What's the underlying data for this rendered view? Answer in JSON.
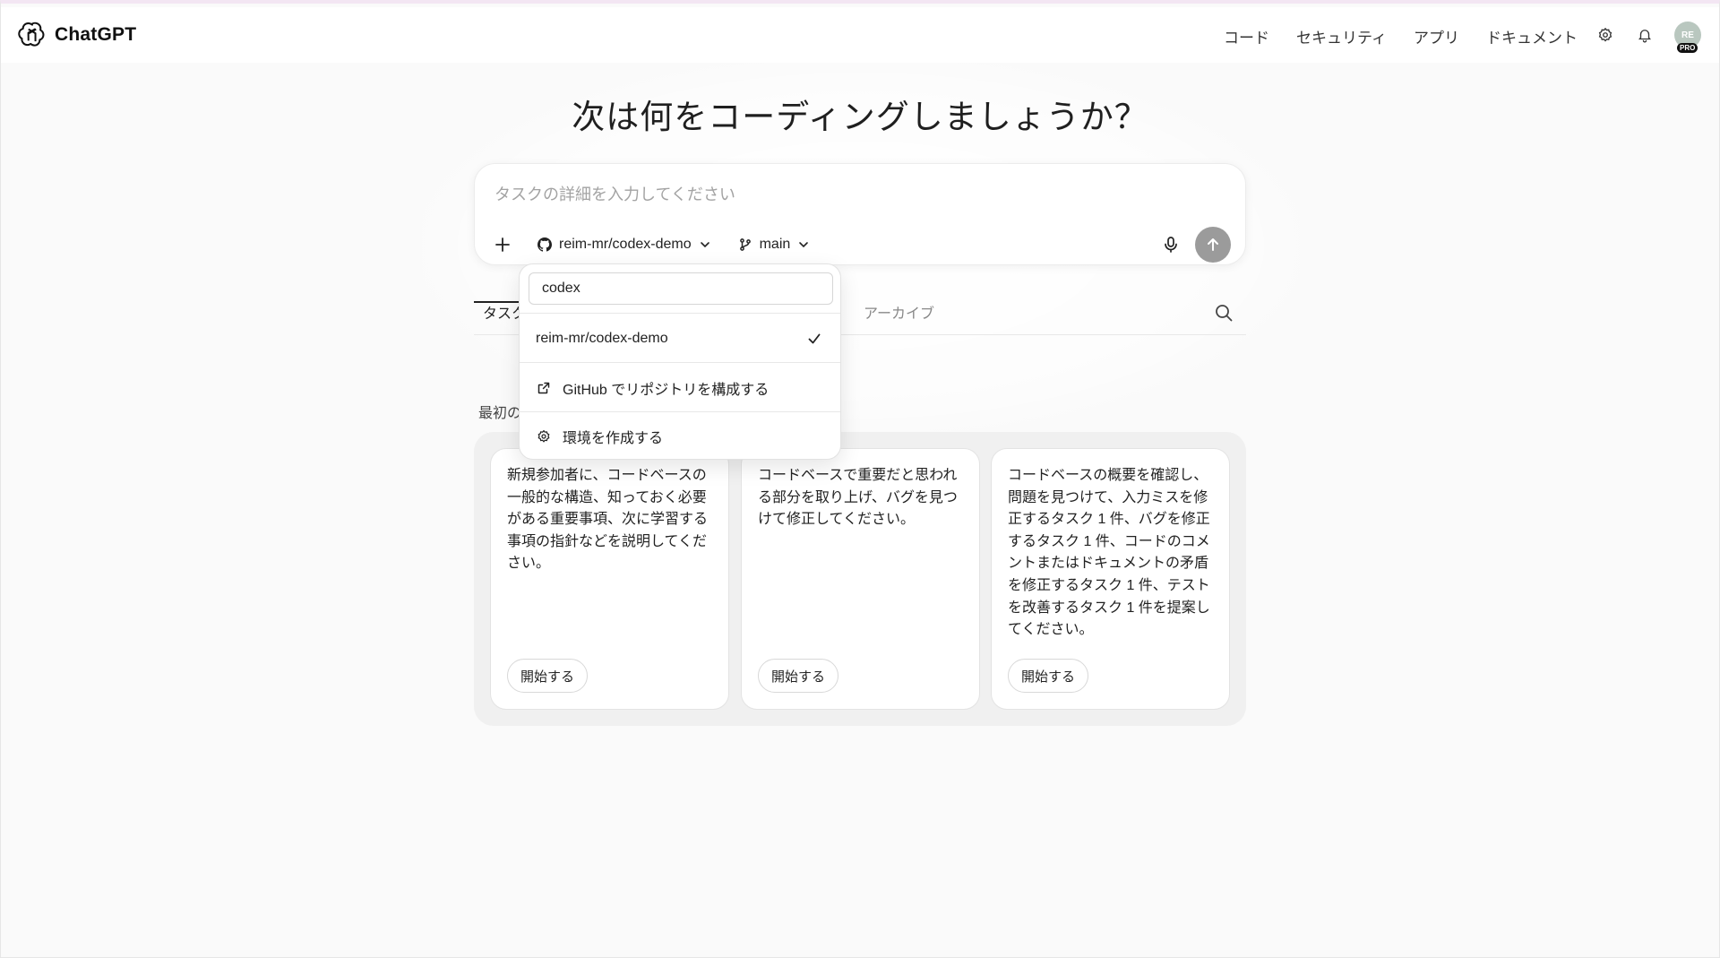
{
  "header": {
    "brand": "ChatGPT",
    "nav": [
      "コード",
      "セキュリティ",
      "アプリ",
      "ドキュメント"
    ],
    "avatar_initials": "RE",
    "avatar_badge": "PRO"
  },
  "main": {
    "headline": "次は何をコーディングしましょうか？",
    "composer": {
      "placeholder": "タスクの詳細を入力してください",
      "repo_label": "reim-mr/codex-demo",
      "branch_label": "main"
    },
    "tabs": {
      "active": "タスク",
      "archive": "アーカイブ"
    },
    "section_label": "最初の",
    "cards": [
      {
        "text": "新規参加者に、コードベースの一般的な構造、知っておく必要がある重要事項、次に学習する事項の指針などを説明してください。",
        "button": "開始する"
      },
      {
        "text": "コードベースで重要だと思われる部分を取り上げ、バグを見つけて修正してください。",
        "button": "開始する"
      },
      {
        "text": "コードベースの概要を確認し、問題を見つけて、入力ミスを修正するタスク 1 件、バグを修正するタスク 1 件、コードのコメントまたはドキュメントの矛盾を修正するタスク 1 件、テストを改善するタスク 1 件を提案してください。",
        "button": "開始する"
      }
    ]
  },
  "dropdown": {
    "search_value": "codex",
    "repo_item": "reim-mr/codex-demo",
    "github_item": "GitHub でリポジトリを構成する",
    "env_item": "環境を作成する"
  },
  "colors": {
    "send_button": "#9b9b9b",
    "background": "#fafafa"
  }
}
